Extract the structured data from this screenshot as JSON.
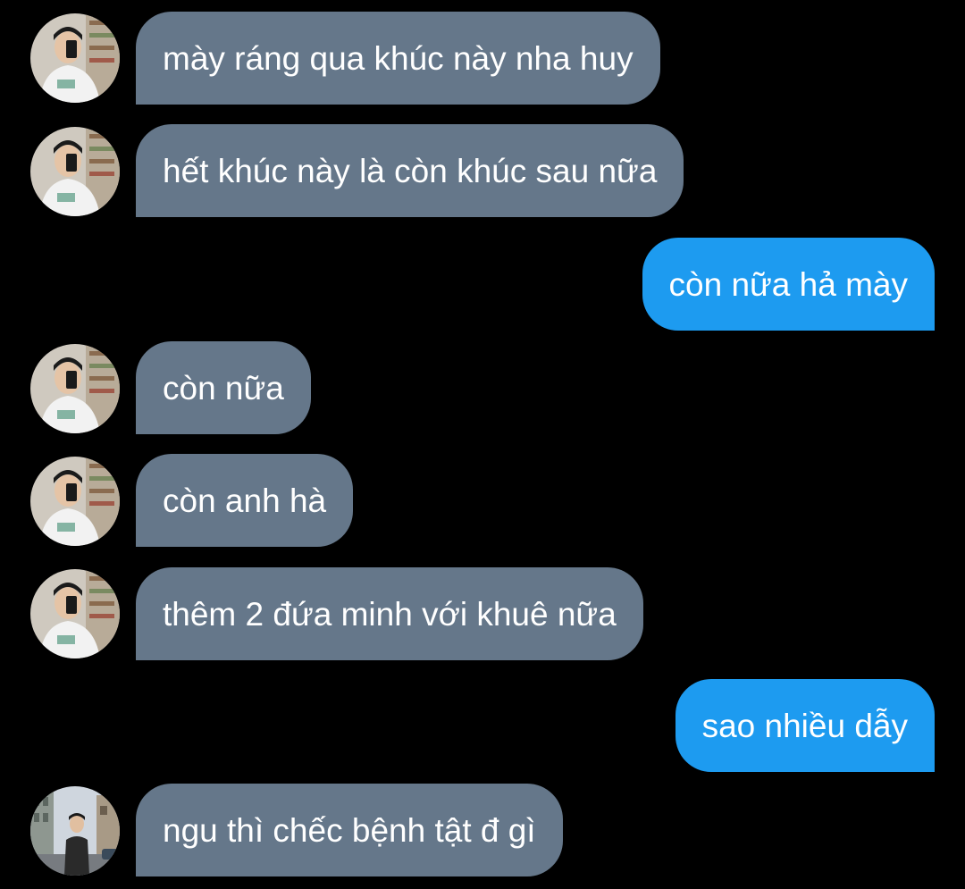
{
  "theme": {
    "background": "#000000",
    "incoming_bubble": "#65778a",
    "outgoing_bubble": "#1d9bf0",
    "text": "#ffffff"
  },
  "messages": [
    {
      "direction": "incoming",
      "text": "mày ráng qua khúc này nha huy",
      "avatar": "selfie-avatar"
    },
    {
      "direction": "incoming",
      "text": "hết khúc này là còn khúc sau nữa",
      "avatar": "selfie-avatar"
    },
    {
      "direction": "outgoing",
      "text": "còn nữa hả mày"
    },
    {
      "direction": "incoming",
      "text": "còn nữa",
      "avatar": "selfie-avatar"
    },
    {
      "direction": "incoming",
      "text": "còn anh hà",
      "avatar": "selfie-avatar"
    },
    {
      "direction": "incoming",
      "text": "thêm 2 đứa minh với khuê nữa",
      "avatar": "selfie-avatar"
    },
    {
      "direction": "outgoing",
      "text": "sao nhiều dẫy"
    },
    {
      "direction": "incoming",
      "text": "ngu thì chếc bệnh tật đ gì",
      "avatar": "street-photo-avatar"
    }
  ]
}
